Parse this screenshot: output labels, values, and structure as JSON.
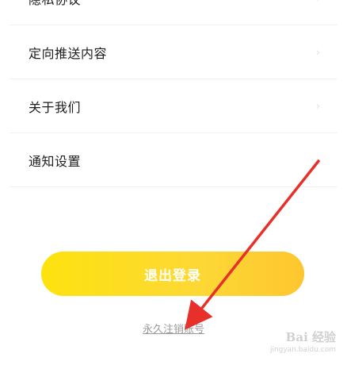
{
  "settings": {
    "items": [
      {
        "label": "隐私协议",
        "chevron": "›"
      },
      {
        "label": "定向推送内容",
        "chevron": "›"
      },
      {
        "label": "关于我们",
        "chevron": "›"
      },
      {
        "label": "通知设置",
        "chevron": "›"
      }
    ]
  },
  "logout": {
    "label": "退出登录"
  },
  "cancel_account": {
    "label": "永久注销账号"
  },
  "annotation": {
    "arrow_color": "#e8302a"
  },
  "watermark": {
    "logo": "Bai 经验",
    "url": "jingyan.baidu.com"
  },
  "colors": {
    "accent_start": "#fde20f",
    "accent_end": "#fdc62f",
    "link": "#9b9b9b"
  },
  "icons": {
    "chevron": "chevron-right-icon"
  }
}
